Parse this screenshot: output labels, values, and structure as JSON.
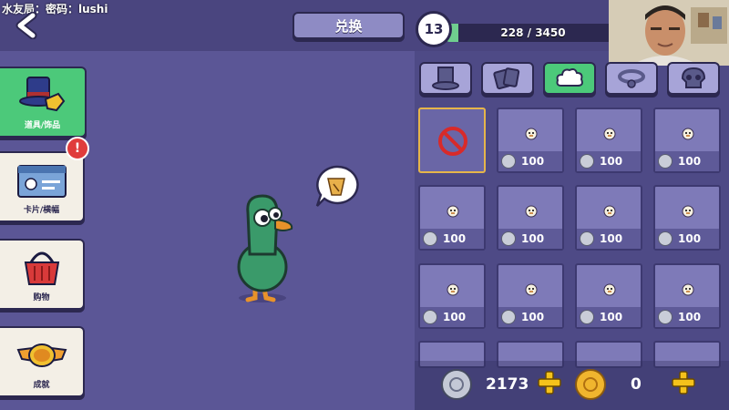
{
  "overlay": {
    "stream_text": "水友局：密码：lushi"
  },
  "header": {
    "exchange_label": "兑换",
    "level": "13",
    "xp_text": "228 / 3450",
    "xp_progress": 0.066
  },
  "sidebar": {
    "items": [
      {
        "label": "道具/饰品",
        "icon": "top-hat-glove-icon",
        "active": true
      },
      {
        "label": "卡片/横幅",
        "icon": "id-card-icon",
        "active": false,
        "alert": "!"
      },
      {
        "label": "购物",
        "icon": "shopping-basket-icon",
        "active": false
      },
      {
        "label": "成就",
        "icon": "ggd-wings-badge-icon",
        "active": false
      }
    ]
  },
  "tabs": [
    {
      "icon": "top-hat-icon",
      "active": false
    },
    {
      "icon": "cards-icon",
      "active": false
    },
    {
      "icon": "poof-cloud-icon",
      "active": true
    },
    {
      "icon": "collar-icon",
      "active": false
    },
    {
      "icon": "skull-icon",
      "active": false
    }
  ],
  "grid": {
    "items": [
      {
        "type": "none",
        "selected": true
      },
      {
        "price": "100"
      },
      {
        "price": "100"
      },
      {
        "price": "100"
      },
      {
        "price": "100"
      },
      {
        "price": "100"
      },
      {
        "price": "100"
      },
      {
        "price": "100"
      },
      {
        "price": "100"
      },
      {
        "price": "100"
      },
      {
        "price": "100"
      },
      {
        "price": "100"
      }
    ]
  },
  "currency": {
    "silver": "2173",
    "gold": "0"
  },
  "colors": {
    "background": "#4e4a86",
    "accent_green": "#4cc97a",
    "outline": "#2c2850",
    "gold": "#f0b52e",
    "plus_yellow": "#f5c21b"
  }
}
